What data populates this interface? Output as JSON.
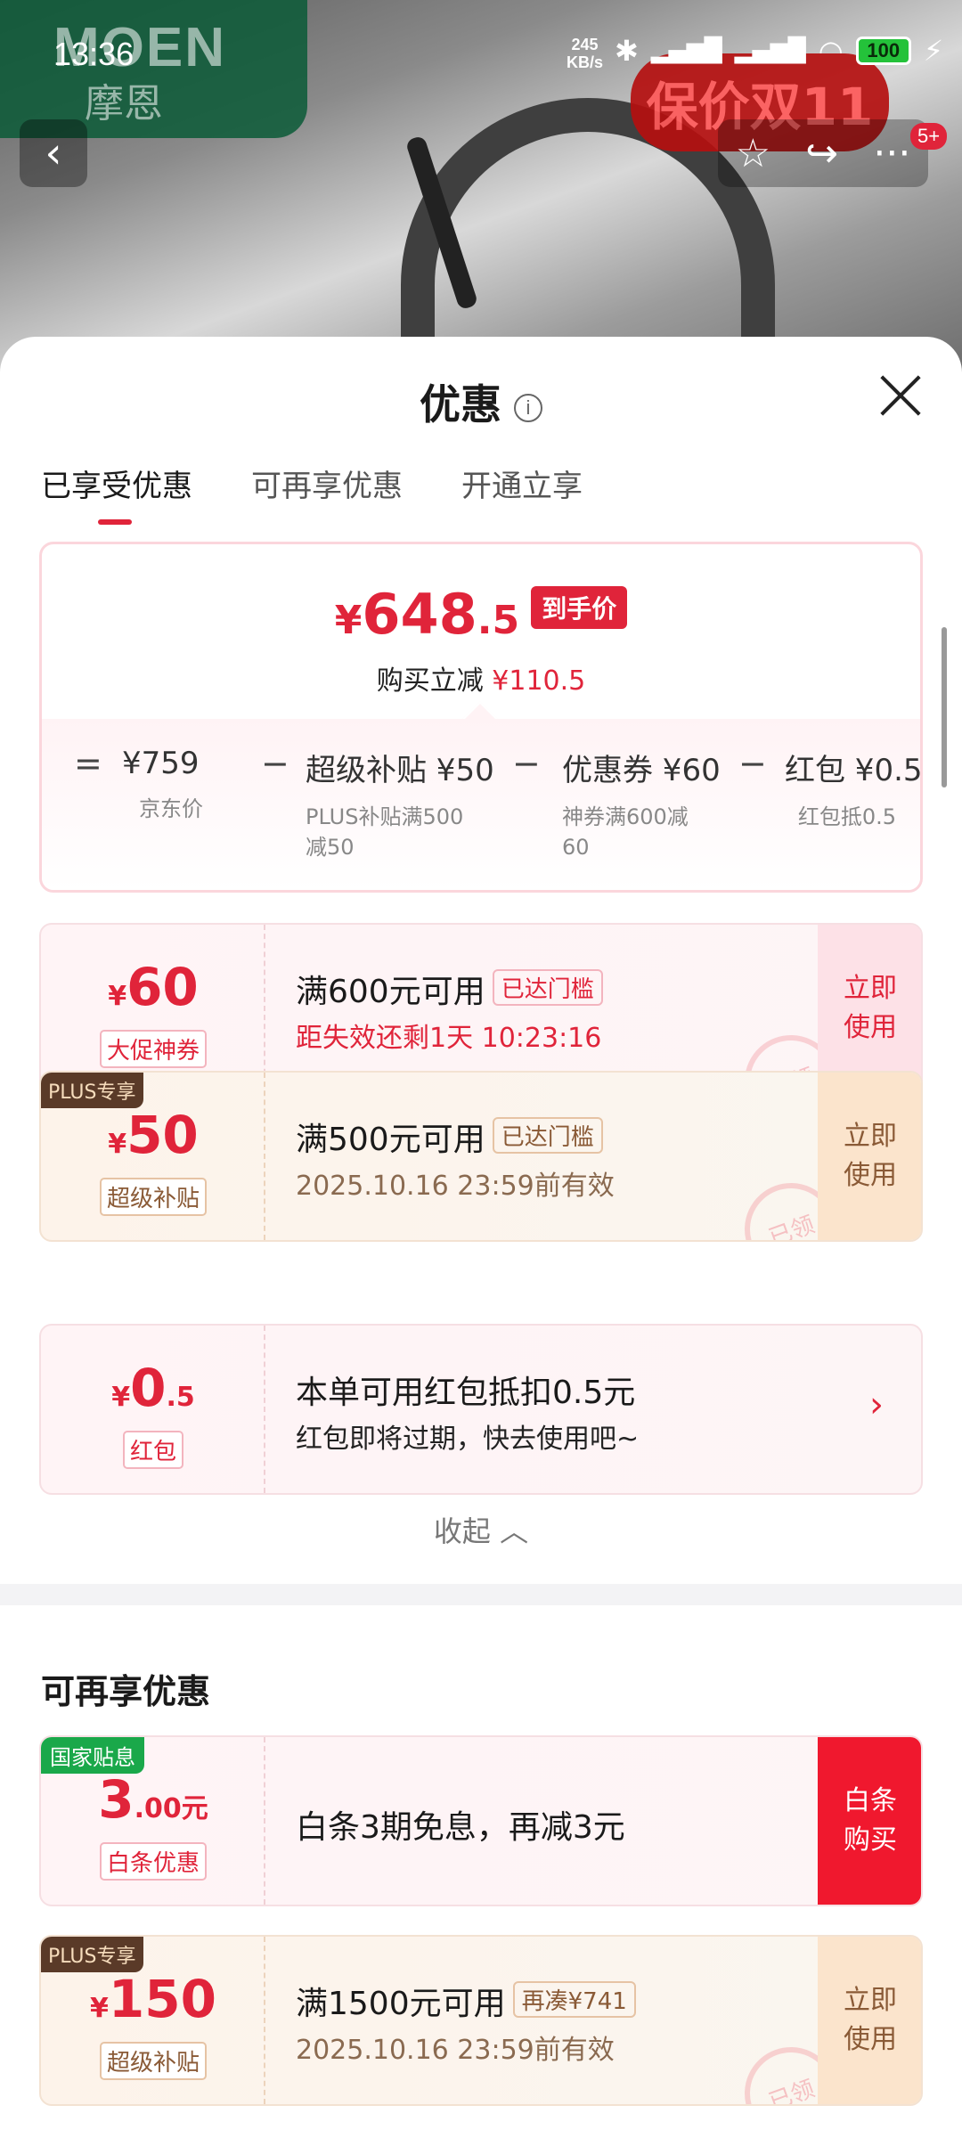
{
  "status_bar": {
    "time": "13:36",
    "net_speed": "245",
    "net_unit": "KB/s",
    "battery": "100"
  },
  "hero": {
    "brand_en": "MOEN",
    "brand_cn": "摩恩",
    "promo": "保价双11",
    "msg_count": "5+"
  },
  "sheet": {
    "title": "优惠",
    "tabs": [
      "已享受优惠",
      "可再享优惠",
      "开通立享"
    ],
    "summary": {
      "currency": "¥",
      "final_int": "648",
      "final_dec": ".5",
      "final_tag": "到手价",
      "saving_label": "购买立减",
      "saving_value": "¥110.5",
      "breakdown": [
        {
          "op": "=",
          "value": "¥759",
          "desc": "京东价"
        },
        {
          "op": "−",
          "value": "超级补贴 ¥50",
          "desc": "PLUS补贴满500减50"
        },
        {
          "op": "−",
          "value": "优惠券 ¥60",
          "desc": "神券满600减60"
        },
        {
          "op": "−",
          "value": "红包 ¥0.5",
          "desc": "红包抵0.5"
        }
      ]
    },
    "coupons": [
      {
        "amount": "60",
        "cur": "¥",
        "small": "",
        "label": "大促神券",
        "title": "满600元可用",
        "chip": "已达门槛",
        "sub": "距失效还剩1天 10:23:16",
        "action": "立即使用",
        "stamp": "已领"
      },
      {
        "tag": "PLUS专享",
        "amount": "50",
        "cur": "¥",
        "small": "",
        "label": "超级补贴",
        "title": "满500元可用",
        "chip": "已达门槛",
        "sub": "2025.10.16 23:59前有效",
        "action": "立即使用",
        "stamp": "已领"
      },
      {
        "amount": "0",
        "cur": "¥",
        "small": ".5",
        "label": "红包",
        "title": "本单可用红包抵扣0.5元",
        "sub": "红包即将过期，快去使用吧~",
        "action": "›"
      }
    ],
    "collapse": "收起",
    "more_title": "可再享优惠",
    "more_coupons": [
      {
        "tag": "国家贴息",
        "amount": "3",
        "cur": "",
        "small": ".00元",
        "label": "白条优惠",
        "title": "白条3期免息，再减3元",
        "action": "白条购买"
      },
      {
        "tag": "PLUS专享",
        "amount": "150",
        "cur": "¥",
        "small": "",
        "label": "超级补贴",
        "title": "满1500元可用",
        "chip": "再凑¥741",
        "sub": "2025.10.16 23:59前有效",
        "action": "立即使用",
        "stamp": "已领"
      }
    ]
  }
}
